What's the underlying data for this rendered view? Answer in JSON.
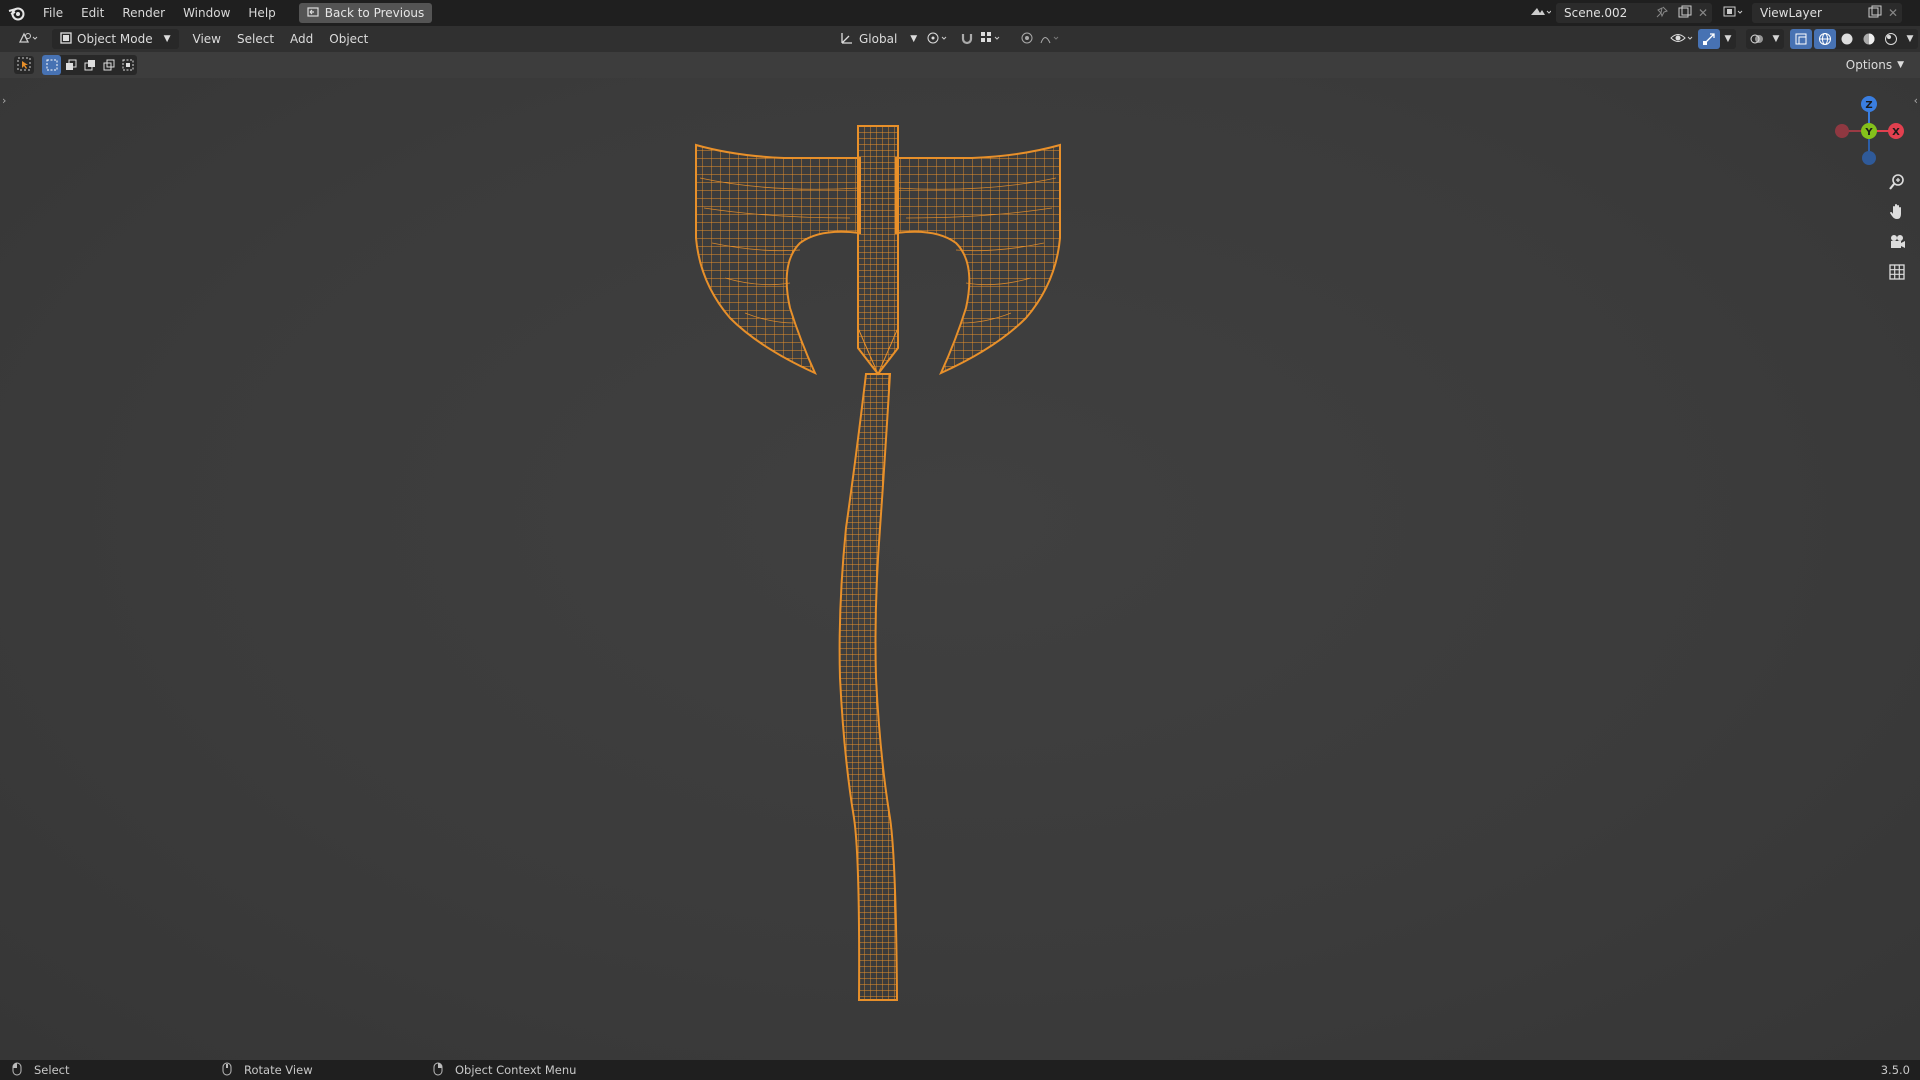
{
  "topbar": {
    "menus": [
      "File",
      "Edit",
      "Render",
      "Window",
      "Help"
    ],
    "back_button": "Back to Previous",
    "scene": "Scene.002",
    "view_layer": "ViewLayer"
  },
  "header": {
    "mode": "Object Mode",
    "menus": [
      "View",
      "Select",
      "Add",
      "Object"
    ],
    "transform_orientation": "Global",
    "options": "Options"
  },
  "gizmo": {
    "z": "Z",
    "y": "Y",
    "x": "X",
    "colors": {
      "x": "#e2404f",
      "y": "#84c01b",
      "z": "#3a7ee0"
    }
  },
  "viewport": {
    "wire_color": "#e8902a",
    "background": "#3d3d3d"
  },
  "statusbar": {
    "select": "Select",
    "rotate": "Rotate View",
    "context": "Object Context Menu",
    "version": "3.5.0"
  }
}
